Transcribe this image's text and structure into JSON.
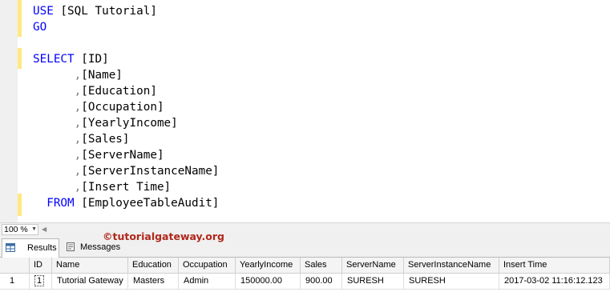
{
  "editor": {
    "lines": [
      [
        {
          "t": "USE",
          "c": "kw"
        },
        {
          "t": " [SQL Tutorial]"
        }
      ],
      [
        {
          "t": "GO",
          "c": "kw"
        }
      ],
      [],
      [
        {
          "t": "SELECT",
          "c": "kw"
        },
        {
          "t": " [ID]"
        }
      ],
      [
        {
          "t": "      "
        },
        {
          "t": ",",
          "c": "pn"
        },
        {
          "t": "[Name]"
        }
      ],
      [
        {
          "t": "      "
        },
        {
          "t": ",",
          "c": "pn"
        },
        {
          "t": "[Education]"
        }
      ],
      [
        {
          "t": "      "
        },
        {
          "t": ",",
          "c": "pn"
        },
        {
          "t": "[Occupation]"
        }
      ],
      [
        {
          "t": "      "
        },
        {
          "t": ",",
          "c": "pn"
        },
        {
          "t": "[YearlyIncome]"
        }
      ],
      [
        {
          "t": "      "
        },
        {
          "t": ",",
          "c": "pn"
        },
        {
          "t": "[Sales]"
        }
      ],
      [
        {
          "t": "      "
        },
        {
          "t": ",",
          "c": "pn"
        },
        {
          "t": "[ServerName]"
        }
      ],
      [
        {
          "t": "      "
        },
        {
          "t": ",",
          "c": "pn"
        },
        {
          "t": "[ServerInstanceName]"
        }
      ],
      [
        {
          "t": "      "
        },
        {
          "t": ",",
          "c": "pn"
        },
        {
          "t": "[Insert Time]"
        }
      ],
      [
        {
          "t": "  "
        },
        {
          "t": "FROM",
          "c": "kw"
        },
        {
          "t": " [EmployeeTableAudit]"
        }
      ]
    ]
  },
  "zoom": "100 %",
  "tabs": {
    "results": "Results",
    "messages": "Messages"
  },
  "watermark": "©tutorialgateway.org",
  "grid": {
    "columns": [
      "",
      "ID",
      "Name",
      "Education",
      "Occupation",
      "YearlyIncome",
      "Sales",
      "ServerName",
      "ServerInstanceName",
      "Insert Time"
    ],
    "rows": [
      [
        "1",
        "1",
        "Tutorial Gateway",
        "Masters",
        "Admin",
        "150000.00",
        "900.00",
        "SURESH",
        "SURESH",
        "2017-03-02 11:16:12.123"
      ]
    ]
  },
  "colors": {
    "keyword": "#0000ff",
    "punct": "#808080",
    "changeBar": "#ffe97f",
    "watermark": "#b1271b"
  }
}
